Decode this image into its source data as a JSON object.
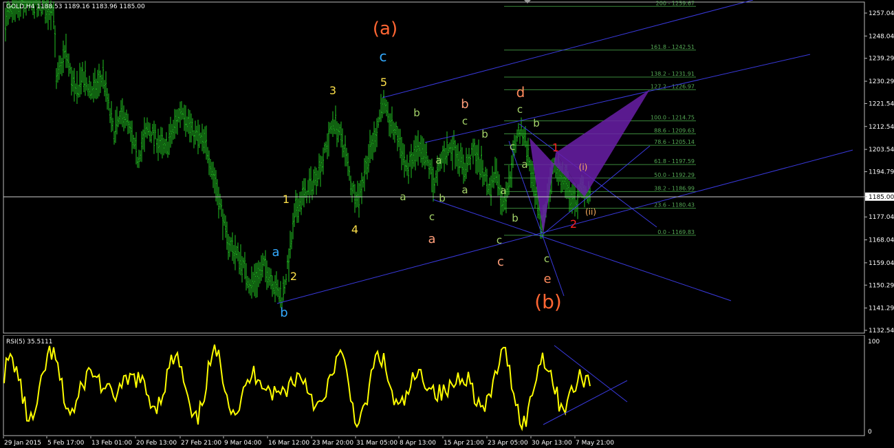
{
  "chart": {
    "symbol_header": "GOLD,H4  1188.53 1189.16 1183.96 1185.00",
    "current_price_label": "1185.00",
    "price_ticks": [
      "1257.04",
      "1248.04",
      "1239.29",
      "1230.29",
      "1221.54",
      "1212.54",
      "1203.54",
      "1194.79",
      "1185.00",
      "1177.04",
      "1168.04",
      "1159.04",
      "1150.29",
      "1141.29",
      "1132.54"
    ],
    "time_ticks": [
      "29 Jan 2015",
      "5 Feb 17:00",
      "13 Feb 01:00",
      "20 Feb 13:00",
      "27 Feb 21:00",
      "9 Mar 04:00",
      "16 Mar 12:00",
      "23 Mar 20:00",
      "31 Mar 05:00",
      "8 Apr 13:00",
      "15 Apr 21:00",
      "23 Apr 05:00",
      "30 Apr 13:00",
      "7 May 21:00"
    ],
    "fib_levels": [
      "200 - 1259.67",
      "161.8 - 1242.51",
      "138.2 - 1231.91",
      "127.2 - 1226.97",
      "100.0 - 1214.75",
      "88.6 - 1209.63",
      "78.6 - 1205.14",
      "61.8 - 1197.59",
      "50.0 - 1192.29",
      "38.2 - 1186.99",
      "23.6 - 1180.43",
      "0.0 - 1169.83"
    ],
    "wave_labels": [
      "(a)",
      "c",
      "5",
      "3",
      "1",
      "2",
      "4",
      "a",
      "b",
      "(b)",
      "d",
      "e",
      "b",
      "c",
      "a",
      "b",
      "c",
      "a",
      "c",
      "b",
      "a",
      "b",
      "a",
      "c",
      "1",
      "2",
      "(i)",
      "(ii)",
      "c",
      "a",
      "b",
      "c",
      "c",
      "b",
      "a",
      "b"
    ],
    "colors": {
      "candle": "#22c322",
      "rsi": "#ffff00",
      "trend": "#3a3adf",
      "fib": "#3c8a3c",
      "pattern": "#6a1fa8",
      "bg": "#000000",
      "grid_text": "#ffffff"
    }
  },
  "rsi": {
    "header": "RSI(5) 35.5111",
    "ticks": [
      "100",
      "0"
    ]
  },
  "chart_data": {
    "type": "line",
    "title": "GOLD,H4",
    "series": [
      {
        "name": "RSI(5)",
        "values": [
          35.5111
        ]
      }
    ],
    "ylim": [
      1132.54,
      1261
    ]
  }
}
